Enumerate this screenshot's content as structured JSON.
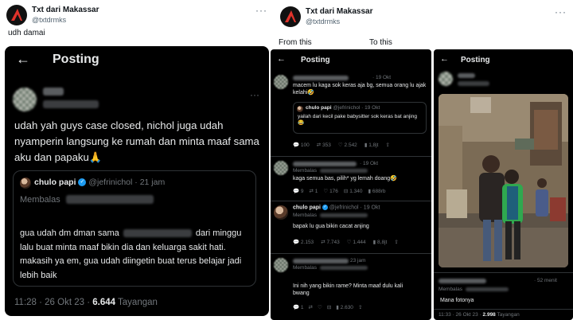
{
  "left": {
    "account_name": "Txt dari Makassar",
    "handle": "@txtdrmks",
    "more": "···",
    "caption": "udh damai",
    "screenshot": {
      "back": "←",
      "title": "Posting",
      "body": "udah yah guys case closed, nichol juga udah nyamperin langsung ke rumah dan minta maaf sama aku dan papaku🙏",
      "quote": {
        "name": "chulo papi",
        "handle": "@jefrinichol",
        "date": "· 21 jam",
        "replying": "Membalas",
        "text_1": "gua udah dm dman sama",
        "text_2": "dari",
        "text_3": "minggu lalu buat minta maaf bikin dia dan keluarga sakit hati. makasih ya em, gua udah diingetin buat terus belajar jadi lebih baik"
      },
      "time": "11:28 · 26 Okt 23 ·",
      "views": "6.644",
      "views_label": "Tayangan"
    }
  },
  "right": {
    "account_name": "Txt dari Makassar",
    "handle": "@txtdrmks",
    "more": "···",
    "from_label": "From this",
    "to_label": "To this",
    "thread": {
      "back": "←",
      "title": "Posting",
      "reply1": {
        "date": "· 19 Okt",
        "text": "macem lu kaga sok keras aja bg, semua orang lu ajak kelahi🤣",
        "quote_name": "chulo papi",
        "quote_handle": "@jefrinichol · 19 Okt",
        "quote_text": "yailah dari kecil pake babysitter sok keras bat anjing😂",
        "stats": [
          "100",
          "353",
          "2.542",
          "1,8jt"
        ]
      },
      "reply2": {
        "date": "· 19 Okt",
        "replying": "Membalas",
        "text": "kaga semua bas, pilih* yg lemah doang🤣",
        "stats": [
          "9",
          "1",
          "176",
          "1.340",
          "688rb"
        ]
      },
      "reply3": {
        "name": "chulo papi",
        "handle": "@jefrinichol · 19 Okt",
        "replying": "Membalas",
        "text": "bapak lu gua bikin cacat anjing",
        "stats": [
          "2.153",
          "7.743",
          "1.444",
          "8,8jt"
        ]
      },
      "reply4": {
        "date": "23 jam",
        "replying": "Membalas",
        "text": "Ini nih yang bikin rame? Minta maaf dulu kali bwang",
        "stats": [
          "1",
          "2.630"
        ]
      }
    },
    "image_post": {
      "back": "←",
      "title": "Posting",
      "reply_date": "· 52 menit",
      "replying": "Membalas",
      "reply_text": "Mana fotonya",
      "time": "11:33 · 26 Okt 23 ·",
      "views": "2.998",
      "views_label": "Tayangan"
    }
  }
}
